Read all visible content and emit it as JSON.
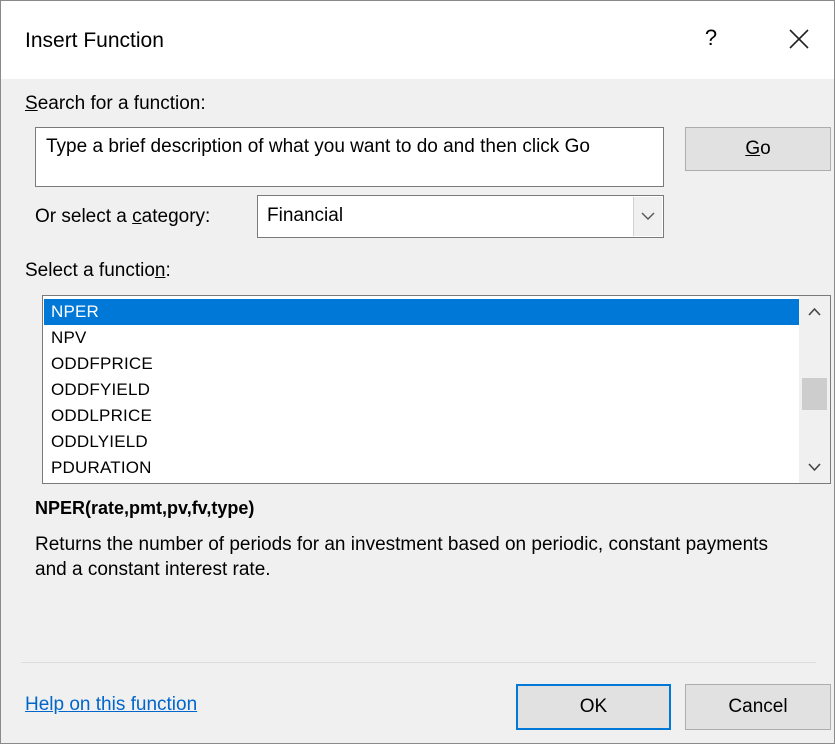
{
  "dialog": {
    "title": "Insert Function",
    "help_glyph": "?",
    "close_icon": "close-icon"
  },
  "search": {
    "label_prefix": "",
    "label_accel": "S",
    "label_rest": "earch for a function:",
    "text": "Type a brief description of what you want to do and then click Go",
    "go_accel": "G",
    "go_rest": "o"
  },
  "category": {
    "label_prefix": "Or select a ",
    "label_accel": "c",
    "label_rest": "ategory:",
    "selected": "Financial",
    "arrow_icon": "chevron-down-icon"
  },
  "functions": {
    "label_prefix": "Select a functio",
    "label_accel": "n",
    "label_rest": ":",
    "items": [
      "NPER",
      "NPV",
      "ODDFPRICE",
      "ODDFYIELD",
      "ODDLPRICE",
      "ODDLYIELD",
      "PDURATION"
    ],
    "selected_index": 0
  },
  "details": {
    "syntax": "NPER(rate,pmt,pv,fv,type)",
    "description": "Returns the number of periods for an investment based on periodic, constant payments and a constant interest rate."
  },
  "footer": {
    "help_link": "Help on this function",
    "ok_label": "OK",
    "cancel_label": "Cancel"
  },
  "colors": {
    "selection": "#0078d7",
    "link": "#0066cc",
    "dialog_bg": "#f0f0f0"
  }
}
